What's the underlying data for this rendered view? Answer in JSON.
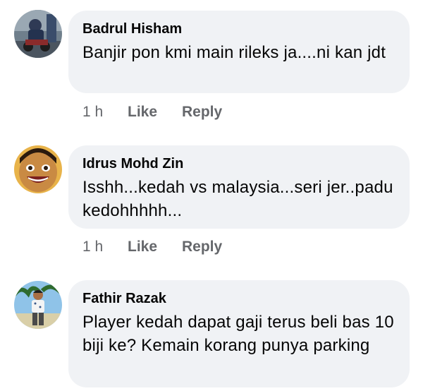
{
  "comments": [
    {
      "author": "Badrul Hisham",
      "text": "Banjir pon kmi main rileks ja....ni kan jdt",
      "time": "1 h",
      "like_label": "Like",
      "reply_label": "Reply"
    },
    {
      "author": "Idrus Mohd Zin",
      "text": "Isshh...kedah vs malaysia...seri jer..padu kedohhhhh...",
      "time": "1 h",
      "like_label": "Like",
      "reply_label": "Reply"
    },
    {
      "author": "Fathir Razak",
      "text": "Player kedah dapat gaji terus beli bas 10 biji ke? Kemain korang punya parking",
      "time": "",
      "like_label": "",
      "reply_label": ""
    }
  ],
  "colors": {
    "bubble": "#f0f2f5",
    "text": "#050505",
    "meta": "#65676b"
  }
}
